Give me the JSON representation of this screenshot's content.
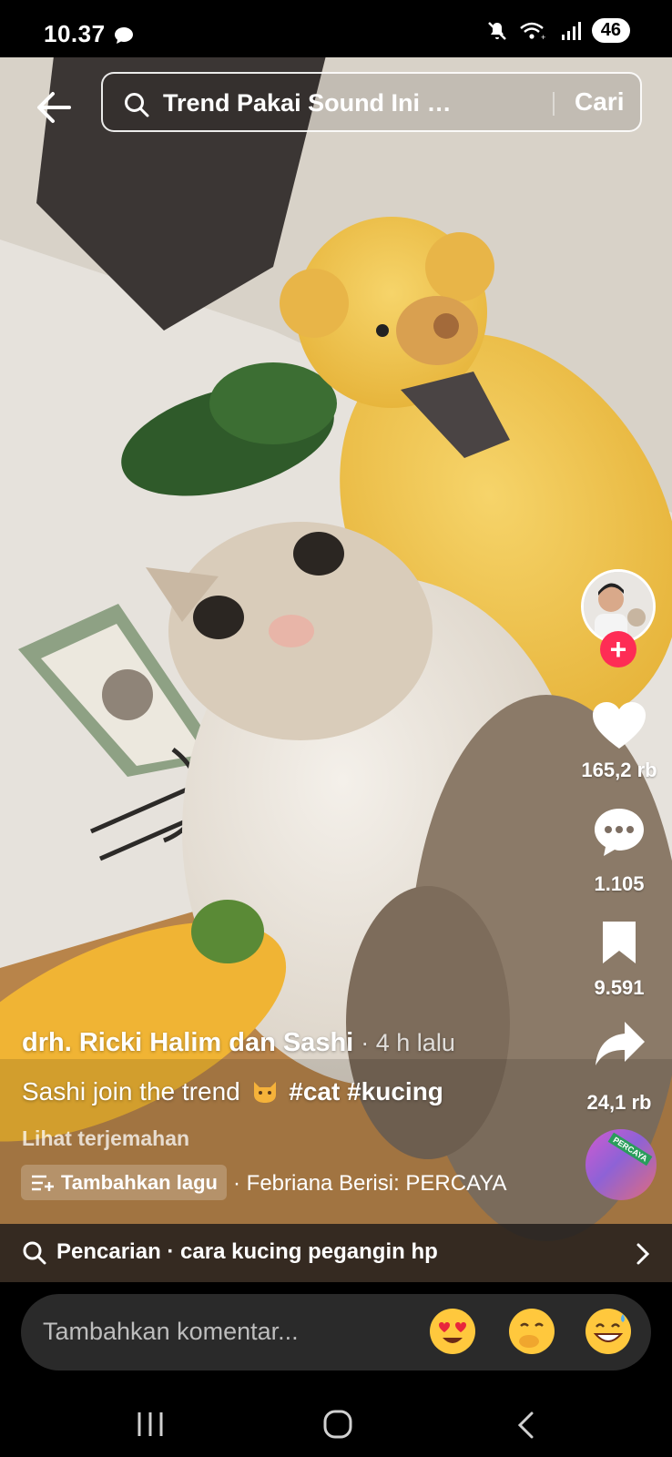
{
  "status_bar": {
    "time": "10.37",
    "battery": "46",
    "icons": [
      "chat-bubble-icon",
      "mute-icon",
      "wifi-icon",
      "signal-icon",
      "battery-icon"
    ]
  },
  "search": {
    "query": "Trend Pakai Sound Ini Ke Ku...",
    "button_label": "Cari"
  },
  "rail": {
    "likes": "165,2 rb",
    "comments": "1.105",
    "saves": "9.591",
    "shares": "24,1 rb",
    "disc_label": "PERCAYA",
    "icons": [
      "heart-icon",
      "comment-icon",
      "bookmark-icon",
      "share-icon"
    ]
  },
  "post": {
    "author": "drh. Ricki Halim dan Sashi",
    "time_ago": "· 4 h lalu",
    "caption_text": "Sashi join the trend",
    "hashtags": "#cat #kucing",
    "translate_label": "Lihat terjemahan",
    "add_song_label": "Tambahkan lagu",
    "music_info": "· Febriana    Berisi: PERCAYA"
  },
  "related_search": {
    "label": "Pencarian · cara kucing pegangin hp"
  },
  "comment": {
    "placeholder": "Tambahkan komentar...",
    "emojis": [
      "heart-eyes-emoji",
      "hand-over-mouth-emoji",
      "grinning-sweat-emoji"
    ]
  },
  "colors": {
    "accent": "#fe2c55",
    "background": "#000000"
  }
}
